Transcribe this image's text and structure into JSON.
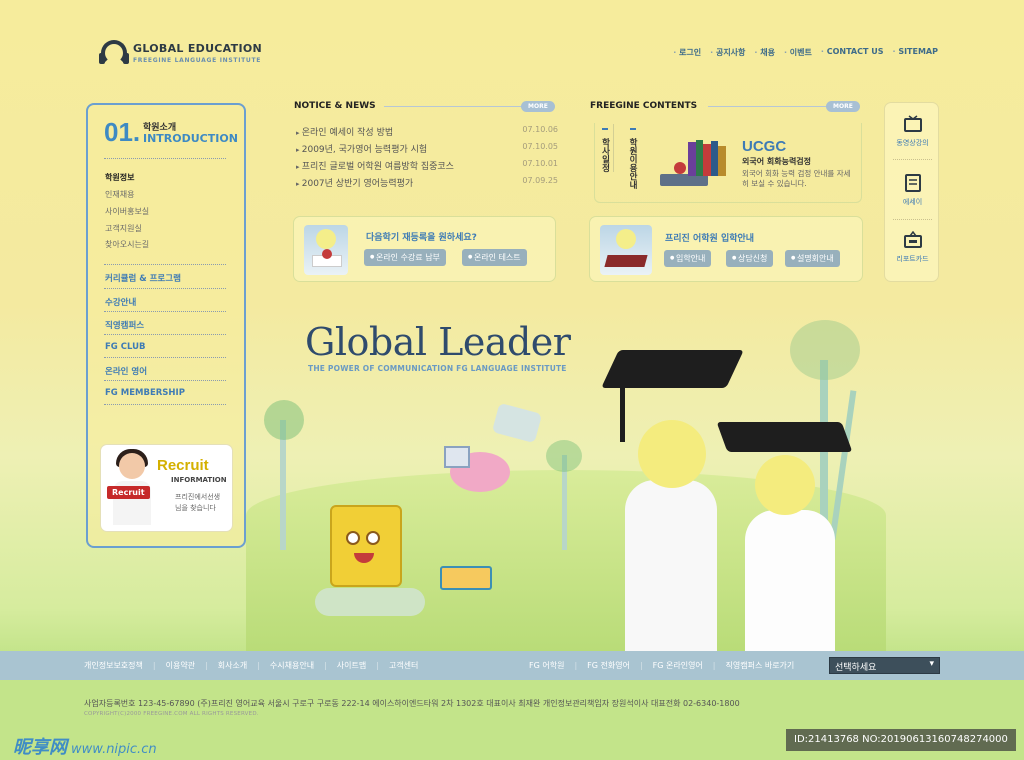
{
  "logo": {
    "title": "GLOBAL EDUCATION",
    "subtitle": "FREEGINE LANGUAGE INSTITUTE"
  },
  "topnav": [
    "로그인",
    "공지사항",
    "채용",
    "이벤트",
    "CONTACT US",
    "SITEMAP"
  ],
  "leftpanel": {
    "number": "01.",
    "title_kor": "학원소개",
    "title_eng": "INTRODUCTION",
    "submenu": [
      "학원정보",
      "인재채용",
      "사이버홍보실",
      "고객지원실",
      "찾아오시는길"
    ],
    "menu": [
      "커리큘럼 & 프로그램",
      "수강안내",
      "직영캠퍼스",
      "FG CLUB",
      "온라인 영어",
      "FG MEMBERSHIP"
    ],
    "recruit": {
      "title": "Recruit",
      "subtitle": "INFORMATION",
      "tag": "Recruit",
      "desc": "프리진에서선생님을 찾습니다"
    }
  },
  "notice": {
    "title": "NOTICE & NEWS",
    "more": "MORE",
    "items": [
      {
        "title": "온라인 예세이 작성 방법",
        "date": "07.10.06"
      },
      {
        "title": "2009년, 국가영어 능력평가 시험",
        "date": "07.10.05"
      },
      {
        "title": "프리진 글로벌 어학원 여름방학 집중코스",
        "date": "07.10.01"
      },
      {
        "title": "2007년 상반기 영어능력평가",
        "date": "07.09.25"
      }
    ]
  },
  "contents": {
    "title": "FREEGINE CONTENTS",
    "more": "MORE",
    "tabs": [
      "학사일정",
      "학원이용안내"
    ],
    "ucgc_title": "UCGC",
    "ucgc_sub": "외국어 회화능력검정",
    "ucgc_desc": "외국어 회화 능력 검정 안내를 자세히 보실 수 있습니다."
  },
  "promo1": {
    "title": "다음학기 재등록을 원하세요?",
    "buttons": [
      "온라인 수강료 납부",
      "온라인 테스트"
    ]
  },
  "promo2": {
    "title": "프리진 어학원 입학안내",
    "buttons": [
      "입학안내",
      "상담신청",
      "설명회안내"
    ]
  },
  "quick": [
    "동영상강의",
    "에세이",
    "리포트카드"
  ],
  "hero": {
    "title": "Global Leader",
    "subtitle": "THE POWER OF COMMUNICATION FG LANGUAGE INSTITUTE"
  },
  "footer": {
    "links": [
      "개인정보보호정책",
      "이용약관",
      "회사소개",
      "수시채용안내",
      "사이트맵",
      "고객센터"
    ],
    "right_links": [
      "FG 어학원",
      "FG 전화영어",
      "FG 온라인영어",
      "직영캠퍼스 바로가기"
    ],
    "select": "선택하세요",
    "address": "사업자등록번호 123-45-67890   (주)프리진 영어교육 서울시 구로구 구로동 222-14 에이스하이엔드타워 2차 1302호   대표이사 최재완   개인정보관리책임자 장원석이사   대표전화 02-6340-1800",
    "copyright": "COPYRIGHT(C)2000 FREEGINE.COM ALL RIGHTS RESERVED."
  },
  "watermark": {
    "brand": "昵享网",
    "url": "www.nipic.cn"
  },
  "image_id": "ID:21413768 NO:20190613160748274000"
}
